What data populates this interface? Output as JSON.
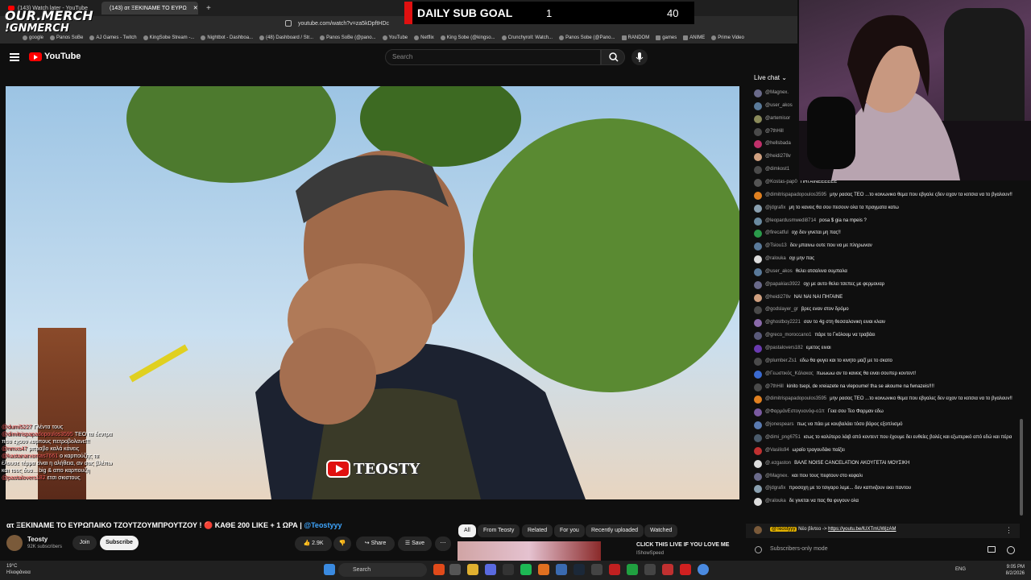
{
  "browser": {
    "tabs": [
      {
        "label": "(143) Watch later - YouTube",
        "active": false
      },
      {
        "label": "(143) ατ ΞΕΚΙΝΑΜΕ ΤΟ ΕΥΡΩ",
        "active": true
      }
    ],
    "url": "youtube.com/watch?v=za5kDpftHDc",
    "bookmarks": [
      "google",
      "Panos SoBe",
      "AJ Games - Twitch",
      "KingSobe Stream -...",
      "Nightbot - Dashboa...",
      "(48) Dashboard / Str...",
      "Panos SoBe (@pano...",
      "YouTube",
      "Netflix",
      "King Sobe (@kingso...",
      "Crunchyroll: Watch...",
      "Panos Sobe (@Pano...",
      "RANDOM",
      "games",
      "ANIME",
      "Prime Video"
    ]
  },
  "overlay": {
    "merch_line1": "OUR.MERCH",
    "merch_line2": "!GNMERCH",
    "subgoal_label": "DAILY SUB GOAL",
    "subgoal_current": "1",
    "subgoal_target": "40"
  },
  "youtube": {
    "logo_text": "YouTube",
    "search_placeholder": "Search",
    "video": {
      "watermark": "TEOSTY",
      "overlay_chat": [
        {
          "user": "@dumi5227",
          "text": "Γλέντα τους"
        },
        {
          "user": "@dimitrispapadopoulos3595",
          "text": "ΤΕΟ τα δεντρα που εχουν καρπους πετροβολανε!!!"
        },
        {
          "user": "@nmxs47",
          "text": "μπραβο καλά κάνεις"
        },
        {
          "user": "@kastanarxontas7661",
          "text": "ο καρπούζης τα έλουσε τέρμα είναι η αλήθεια, αν σας βλέπω και τους δυο... big & απο καρπουζη"
        },
        {
          "user": "@pastalovers182",
          "text": "ετσι σκιστους"
        }
      ]
    },
    "title_prefix": "ατ ΞΕΚΙΝΑΜΕ ΤΟ ΕΥΡΩΠΑΙΚΟ ΤΖΟΥΤΖΟΥΜΠΡΟΥΤΖΟΥ ! 🔴 ΚΑΘΕ 200 LIKE + 1 ΩΡΑ |",
    "title_tag": "@Teostyyy",
    "channel_name": "Teosty",
    "channel_subs": "92K subscribers",
    "join_label": "Join",
    "subscribe_label": "Subscribe",
    "like_count": "2.9K",
    "share_label": "Share",
    "save_label": "Save",
    "chips": [
      "All",
      "From Teosty",
      "Related",
      "For you",
      "Recently uploaded",
      "Watched"
    ],
    "rec_title": "CLICK THIS LIVE IF YOU LOVE ME",
    "rec_channel": "IShowSpeed"
  },
  "chat": {
    "header": "Live chat",
    "messages": [
      {
        "user": "@Magnex.",
        "text": "",
        "color": "#6a6a8a"
      },
      {
        "user": "@user_akos",
        "text": "",
        "color": "#5a7a9a"
      },
      {
        "user": "@artemisor",
        "text": "",
        "color": "#8a8a5a"
      },
      {
        "user": "@7thHill",
        "text": "",
        "color": "#4a4a4a"
      },
      {
        "user": "@hellsbada",
        "text": "",
        "color": "#c0306a"
      },
      {
        "user": "@heidi278v",
        "text": "",
        "color": "#d0a080"
      },
      {
        "user": "@dimkost1",
        "text": "",
        "color": "#4a4a4a"
      },
      {
        "user": "@Kostas-pap0",
        "text": "ΠΗΓΑΙΝΕΕΕΕΕΕ",
        "color": "#555"
      },
      {
        "user": "@dimitrispapadopoulos3595",
        "text": "μην ρασας ΤΕΟ ...το κοινωνικο θεμα που εβγαλε ςδεν ειχαν τα κοτσια να το βγαλουν!!",
        "color": "#e08020"
      },
      {
        "user": "@jdgrafix",
        "text": "μη το κανεις θα σου πεσουν ολα τα πραγματα κατω",
        "color": "#8aa0b0"
      },
      {
        "user": "@leopardusmwedi8714",
        "text": "posa $ gia na mpeis ?",
        "color": "#6a8aa0"
      },
      {
        "user": "@firecatful",
        "text": "οχι δεν γινεται μη πας!!",
        "color": "#2a9a4a"
      },
      {
        "user": "@Tsiou13",
        "text": "δεν μπαινω ουτε που να με πληρωναν",
        "color": "#5a7a9a"
      },
      {
        "user": "@ralouka",
        "text": "οχι μην πας",
        "color": "#ddd"
      },
      {
        "user": "@user_akos",
        "text": "θελει ατσαλινα ουμπαλα",
        "color": "#5a7a9a"
      },
      {
        "user": "@papakias3922",
        "text": "οχι με αυτο θελει τσεπες με φερμουαρ",
        "color": "#6a6a8a"
      },
      {
        "user": "@heidi278v",
        "text": "ΝΑΙ ΝΑΙ ΝΑΙ ΠΗΓΑΙΝΕ",
        "color": "#d0a080"
      },
      {
        "user": "@godslayer_gr",
        "text": "βρες εναν στον δρόμο",
        "color": "#4a4a4a"
      },
      {
        "user": "@ghostboy2221",
        "text": "σαν το 4g στη θεσσαλονικη ειναι κλαιν",
        "color": "#8a6aaa"
      },
      {
        "user": "@greco_moroccano1",
        "text": "πάρε το Γκόλουμ να τραβάει",
        "color": "#5a5a7a"
      },
      {
        "user": "@pastalovers182",
        "text": "εμετος ειναι",
        "color": "#6a3ab0"
      },
      {
        "user": "@plumber.Zs1",
        "text": "εδω θα φυγει και το κινητο μαζί με το σκατο",
        "color": "#4a4a4a"
      },
      {
        "user": "@Γεωστικός_Κάλακας",
        "text": "πωωωω αν το κανεις θα ειναι σουπερ κοντεντ!",
        "color": "#3a6ad0"
      },
      {
        "user": "@7thHill",
        "text": "kinito tsepi, de xreiazete na vlepoume! tha se akoume na fwnazeis!!!!",
        "color": "#4a4a4a"
      },
      {
        "user": "@dimitrispapadopoulos3595",
        "text": "μην ρασας ΤΕΟ ...το κοινωνικο θεμα που εβγαλες δεν ειχαν τα κοτσια να το βγαλουν!!",
        "color": "#e08020"
      },
      {
        "user": "@ΦαρμάνΕστογυανόφ-ο1π",
        "text": "Γεια σου Τεο Φαρμαν εδω",
        "color": "#7a5aa0"
      },
      {
        "user": "@jonespears",
        "text": "πως να πάει με κουβαλάει τόσο βάρος εξοπλισμό",
        "color": "#5a7ab0"
      },
      {
        "user": "@dimi_png6751",
        "text": "ισως το καλύτερο λάιβ από κοντεντ που έχουμε δει ευθείες βολές και εξωτερικό από εδώ και πέρα",
        "color": "#4a5a6a"
      },
      {
        "user": "@Vasilis94",
        "text": "ωραίο τραγουδάκι παίζει",
        "color": "#c03030"
      },
      {
        "user": "@.ezgaston",
        "text": "ΒΑΛΕ NOISE CANCELATION ΑΚΟΥΓΕΤΑΙ ΜΟΥΣΙΚΗ",
        "color": "#ddd"
      },
      {
        "user": "@Magnex.",
        "text": "και που τους πεφτουν στο κεφαλι",
        "color": "#6a6a8a"
      },
      {
        "user": "@jdgrafix",
        "text": "προσοχη με το τσιγαρο λεμε... δεν καπνιζουν εκει παντου",
        "color": "#8aa0b0"
      },
      {
        "user": "@ralouka",
        "text": "δε γινεται να πας θα φυγουν ολα",
        "color": "#ddd"
      }
    ],
    "pinned_user": "@Teostyyy",
    "pinned_text": "Νέο βίντεο ->",
    "pinned_link": "https://youtu.be/lUXTmUWjzAM",
    "subs_only": "Subscribers-only mode"
  },
  "taskbar": {
    "weather_temp": "19°C",
    "weather_desc": "Ηλιοφάνεια",
    "search_label": "Search",
    "lang": "ENG",
    "time": "9:05 PM",
    "date": "8/2/2026"
  }
}
